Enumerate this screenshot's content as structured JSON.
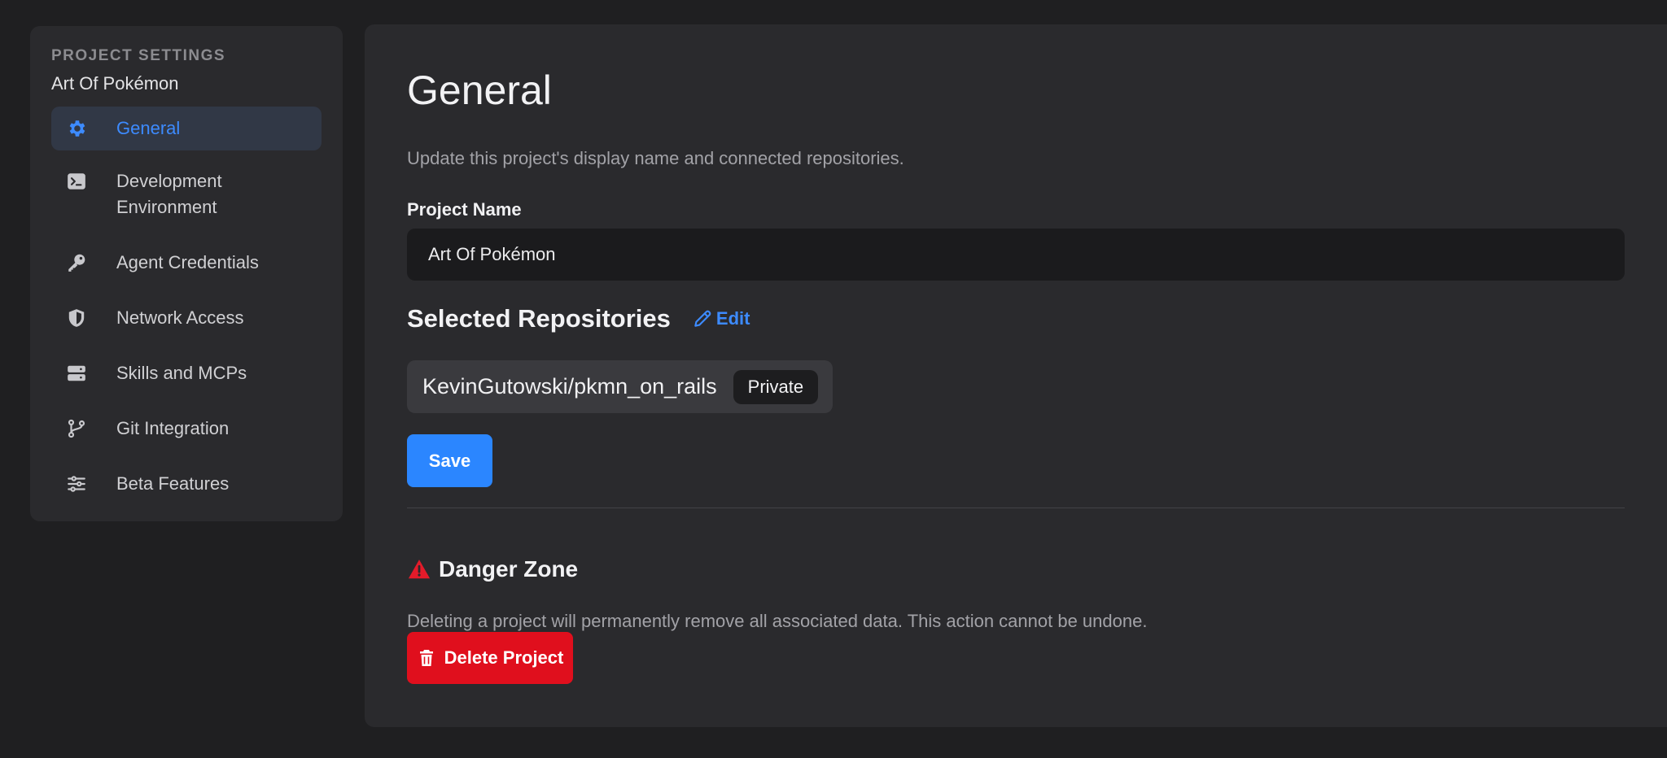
{
  "sidebar": {
    "eyebrow": "PROJECT SETTINGS",
    "project_name": "Art Of Pokémon",
    "items": [
      {
        "label": "General",
        "icon": "gear-icon",
        "active": true
      },
      {
        "label": "Development Environment",
        "icon": "terminal-icon",
        "active": false
      },
      {
        "label": "Agent Credentials",
        "icon": "key-icon",
        "active": false
      },
      {
        "label": "Network Access",
        "icon": "shield-icon",
        "active": false
      },
      {
        "label": "Skills and MCPs",
        "icon": "server-icon",
        "active": false
      },
      {
        "label": "Git Integration",
        "icon": "git-branch-icon",
        "active": false
      },
      {
        "label": "Beta Features",
        "icon": "sliders-icon",
        "active": false
      }
    ]
  },
  "main": {
    "title": "General",
    "description": "Update this project's display name and connected repositories.",
    "project_name_label": "Project Name",
    "project_name_value": "Art Of Pokémon",
    "repos_title": "Selected Repositories",
    "edit_label": "Edit",
    "repositories": [
      {
        "name": "KevinGutowski/pkmn_on_rails",
        "visibility": "Private"
      }
    ],
    "save_label": "Save",
    "danger_zone": {
      "title": "Danger Zone",
      "description": "Deleting a project will permanently remove all associated data. This action cannot be undone.",
      "delete_label": "Delete Project"
    }
  },
  "colors": {
    "background": "#1f1f21",
    "panel": "#2a2a2d",
    "accent": "#2b86ff",
    "danger": "#e00f1d"
  }
}
